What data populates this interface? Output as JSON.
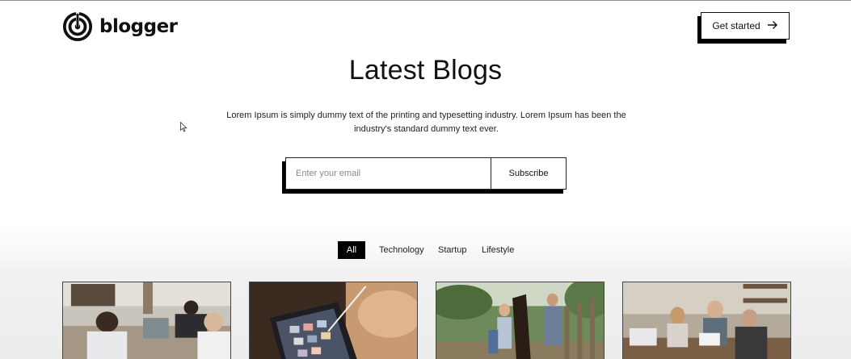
{
  "header": {
    "logo_text": "blogger",
    "cta_label": "Get started",
    "cta_icon": "arrow-right-icon",
    "logo_icon": "blogger-logo-icon"
  },
  "hero": {
    "title": "Latest Blogs",
    "description": "Lorem Ipsum is simply dummy text of the printing and typesetting industry. Lorem Ipsum has been the industry's standard dummy text ever."
  },
  "subscribe": {
    "placeholder": "Enter your email",
    "value": "",
    "button_label": "Subscribe"
  },
  "filters": [
    {
      "label": "All",
      "active": true
    },
    {
      "label": "Technology",
      "active": false
    },
    {
      "label": "Startup",
      "active": false
    },
    {
      "label": "Lifestyle",
      "active": false
    }
  ],
  "cards": [
    {
      "image": "office-meeting-photo"
    },
    {
      "image": "tablet-design-photo"
    },
    {
      "image": "family-with-horse-photo"
    },
    {
      "image": "team-laptop-photo"
    }
  ],
  "colors": {
    "accent": "#000000",
    "background": "#ffffff",
    "text": "#111111"
  }
}
